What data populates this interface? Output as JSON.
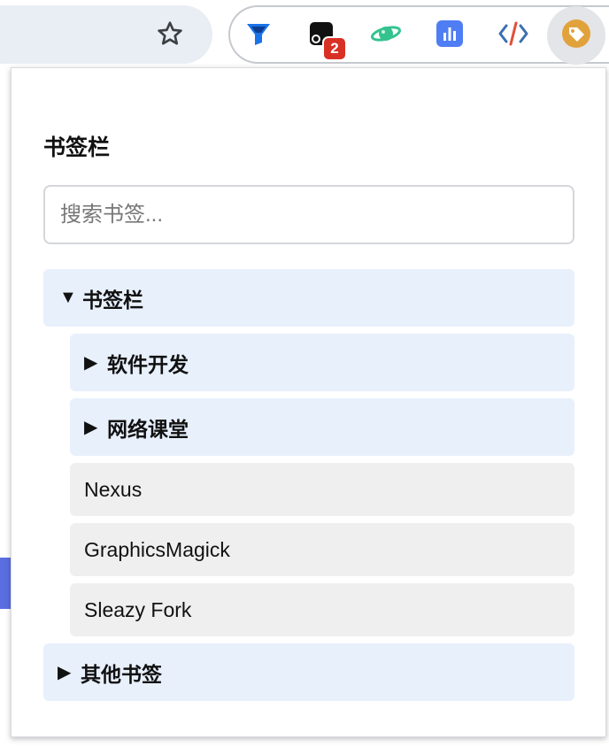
{
  "toolbar": {
    "star_icon": "star-outline-icon",
    "extensions": [
      {
        "name": "filter-funnel-icon",
        "color": "#1a73e8"
      },
      {
        "name": "tab-manager-icon",
        "badge": "2",
        "badge_color": "#d93025"
      },
      {
        "name": "planet-icon",
        "color": "#34c38f"
      },
      {
        "name": "bar-chart-icon",
        "color": "#4f7df3"
      },
      {
        "name": "code-icon",
        "color": "#e0503c"
      },
      {
        "name": "bookmark-tag-icon",
        "color": "#e2a23b"
      }
    ]
  },
  "popup": {
    "title": "书签栏",
    "search_placeholder": "搜索书签...",
    "root_folder": {
      "label": "书签栏",
      "expanded_arrow": "▼"
    },
    "subfolders": [
      {
        "label": "软件开发",
        "arrow": "▶"
      },
      {
        "label": "网络课堂",
        "arrow": "▶"
      }
    ],
    "bookmarks": [
      {
        "label": "Nexus"
      },
      {
        "label": "GraphicsMagick"
      },
      {
        "label": "Sleazy Fork"
      }
    ],
    "other_folder": {
      "label": "其他书签",
      "arrow": "▶"
    }
  },
  "colors": {
    "folder_bg": "#e8f0fc",
    "bookmark_bg": "#efefef",
    "address_bar_bg": "#e9edf4"
  }
}
